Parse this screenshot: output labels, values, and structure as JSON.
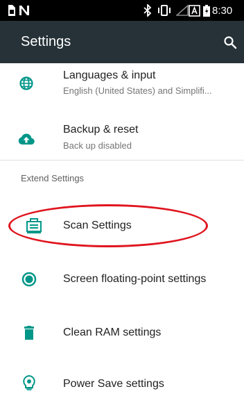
{
  "status_bar": {
    "time": "8:30",
    "icons": [
      "sim-card-icon",
      "signal-n-icon",
      "bluetooth-icon",
      "vibrate-icon",
      "signal-strength-icon",
      "a-badge-icon",
      "battery-icon"
    ]
  },
  "header": {
    "title": "Settings",
    "search_icon": "search-icon"
  },
  "items": [
    {
      "title": "Languages & input",
      "subtitle": "English (United States) and Simplifi...",
      "icon": "globe-icon"
    },
    {
      "title": "Backup & reset",
      "subtitle": "Back up disabled",
      "icon": "cloud-upload-icon"
    }
  ],
  "section": {
    "label": "Extend Settings"
  },
  "extend_items": [
    {
      "title": "Scan Settings",
      "icon": "scanner-icon"
    },
    {
      "title": "Screen floating-point settings",
      "icon": "floating-point-icon"
    },
    {
      "title": "Clean RAM settings",
      "icon": "trash-icon"
    },
    {
      "title": "Power Save settings",
      "icon": "power-save-icon"
    }
  ],
  "colors": {
    "status_bar": "#000000",
    "app_bar": "#263238",
    "accent": "#009688",
    "annotation": "#e0141e"
  }
}
